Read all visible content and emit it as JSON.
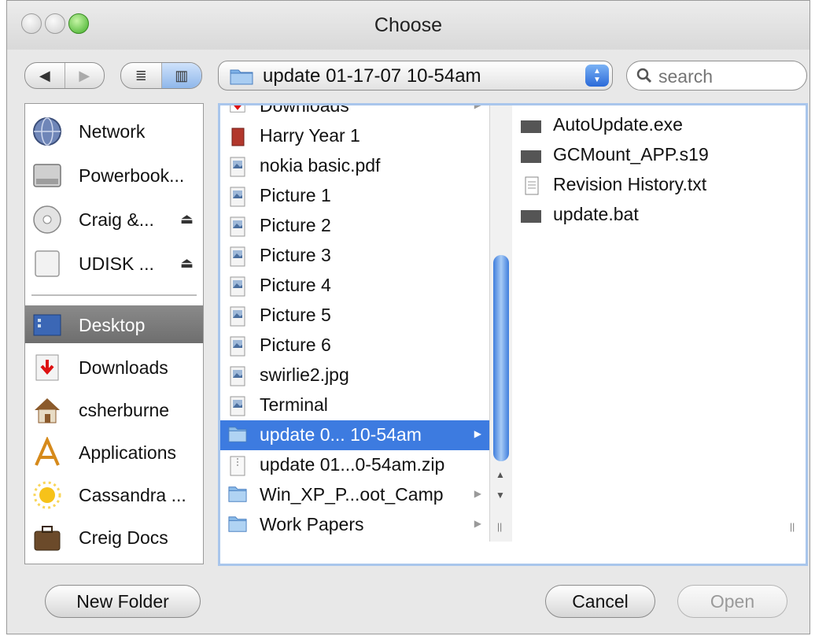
{
  "window": {
    "title": "Choose"
  },
  "toolbar": {
    "back": "◀",
    "forward": "▶",
    "list_view": "≣",
    "column_view": "▥",
    "path_label": "update 01-17-07 10-54am",
    "search_placeholder": "search"
  },
  "sidebar": {
    "devices": [
      {
        "label": "Network",
        "icon": "network-globe-icon",
        "eject": ""
      },
      {
        "label": "Powerbook...",
        "icon": "hard-disk-icon",
        "eject": ""
      },
      {
        "label": "Craig &...",
        "icon": "cd-disc-icon",
        "eject": "⏏"
      },
      {
        "label": "UDISK ...",
        "icon": "removable-disk-icon",
        "eject": "⏏"
      }
    ],
    "places": [
      {
        "label": "Desktop",
        "icon": "desktop-icon",
        "selected": true
      },
      {
        "label": "Downloads",
        "icon": "downloads-icon"
      },
      {
        "label": "csherburne",
        "icon": "home-icon"
      },
      {
        "label": "Applications",
        "icon": "applications-icon"
      },
      {
        "label": "Cassandra ...",
        "icon": "sun-icon"
      },
      {
        "label": "Creig Docs",
        "icon": "briefcase-icon"
      }
    ]
  },
  "browser": {
    "column1": [
      {
        "name": "Downloads",
        "kind": "folder-red",
        "arrow": true
      },
      {
        "name": "Harry Year 1",
        "kind": "book"
      },
      {
        "name": "nokia basic.pdf",
        "kind": "preview"
      },
      {
        "name": "Picture 1",
        "kind": "preview"
      },
      {
        "name": "Picture 2",
        "kind": "preview"
      },
      {
        "name": "Picture 3",
        "kind": "preview"
      },
      {
        "name": "Picture 4",
        "kind": "preview"
      },
      {
        "name": "Picture 5",
        "kind": "preview"
      },
      {
        "name": "Picture 6",
        "kind": "preview"
      },
      {
        "name": "swirlie2.jpg",
        "kind": "preview"
      },
      {
        "name": "Terminal",
        "kind": "preview"
      },
      {
        "name": "update 0... 10-54am",
        "kind": "folder",
        "arrow": true,
        "selected": true
      },
      {
        "name": "update 01...0-54am.zip",
        "kind": "zip"
      },
      {
        "name": "Win_XP_P...oot_Camp",
        "kind": "folder",
        "arrow": true
      },
      {
        "name": "Work Papers",
        "kind": "folder",
        "arrow": true
      }
    ],
    "column2": [
      {
        "name": "AutoUpdate.exe",
        "kind": "exe"
      },
      {
        "name": "GCMount_APP.s19",
        "kind": "exe"
      },
      {
        "name": "Revision History.txt",
        "kind": "text"
      },
      {
        "name": "update.bat",
        "kind": "exe"
      }
    ]
  },
  "buttons": {
    "new_folder": "New Folder",
    "cancel": "Cancel",
    "open": "Open"
  },
  "colors": {
    "selection": "#3d7be0",
    "sidebar_selected": "#7a7a7a",
    "focus_ring": "#a9c6ec"
  }
}
